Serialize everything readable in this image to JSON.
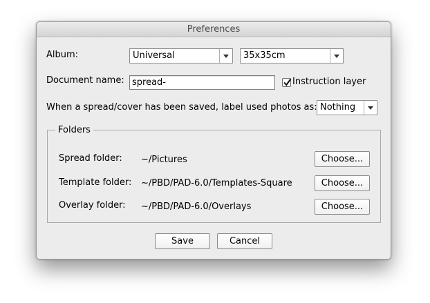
{
  "window": {
    "title": "Preferences"
  },
  "album": {
    "label": "Album:",
    "type_value": "Universal",
    "size_value": "35x35cm"
  },
  "document": {
    "label": "Document name:",
    "value": "spread-",
    "instruction_layer_label": "Instruction layer",
    "instruction_layer_checked": true
  },
  "label_used": {
    "text": "When a spread/cover has been saved, label used photos as:",
    "value": "Nothing"
  },
  "folders": {
    "title": "Folders",
    "rows": [
      {
        "label": "Spread folder:",
        "path": "~/Pictures",
        "button": "Choose..."
      },
      {
        "label": "Template folder:",
        "path": "~/PBD/PAD-6.0/Templates-Square",
        "button": "Choose..."
      },
      {
        "label": "Overlay folder:",
        "path": "~/PBD/PAD-6.0/Overlays",
        "button": "Choose..."
      }
    ]
  },
  "buttons": {
    "save": "Save",
    "cancel": "Cancel"
  },
  "icons": {
    "dropdown": "chevron-down-icon",
    "check": "checkmark-icon"
  }
}
